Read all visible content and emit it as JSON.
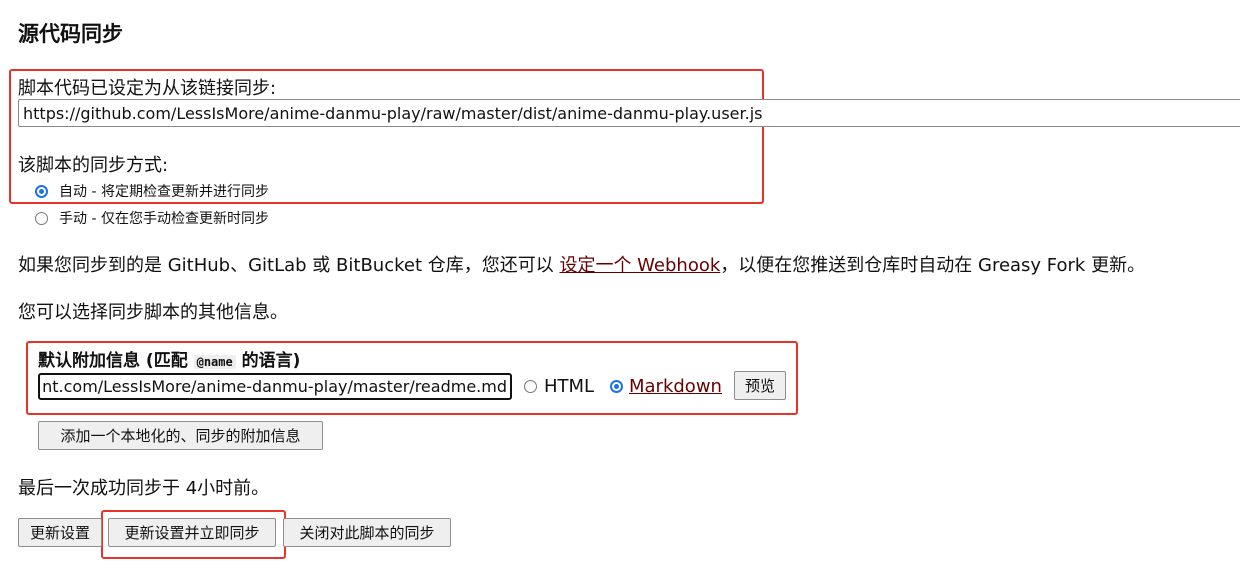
{
  "section_title": "源代码同步",
  "sync_source": {
    "label": "脚本代码已设定为从该链接同步:",
    "url": "https://github.com/LessIsMore/anime-danmu-play/raw/master/dist/anime-danmu-play.user.js"
  },
  "sync_mode": {
    "label": "该脚本的同步方式:",
    "options": [
      {
        "label": "自动 - 将定期检查更新并进行同步",
        "checked": true
      },
      {
        "label": "手动 - 仅在您手动检查更新时同步",
        "checked": false
      }
    ]
  },
  "webhook_text": {
    "before": "如果您同步到的是 GitHub、GitLab 或 BitBucket 仓库，您还可以 ",
    "link": "设定一个 Webhook",
    "after": "，以便在您推送到仓库时自动在 Greasy Fork 更新。"
  },
  "additional_info_intro": "您可以选择同步脚本的其他信息。",
  "default_info": {
    "title_before": "默认附加信息 (匹配 ",
    "title_code": "@name",
    "title_after": " 的语言)",
    "url": "https://raw.githubusercontent.com/LessIsMore/anime-danmu-play/master/readme.md",
    "format_html": "HTML",
    "format_markdown": "Markdown",
    "selected_format": "markdown",
    "preview_button": "预览"
  },
  "add_localized_button": "添加一个本地化的、同步的附加信息",
  "last_sync_text": "最后一次成功同步于 4小时前。",
  "buttons": {
    "update_settings": "更新设置",
    "update_and_sync": "更新设置并立即同步",
    "disable_sync": "关闭对此脚本的同步"
  },
  "colors": {
    "highlight_box": "#e8332b",
    "link": "#670000",
    "radio_checked": "#1a73e8"
  }
}
